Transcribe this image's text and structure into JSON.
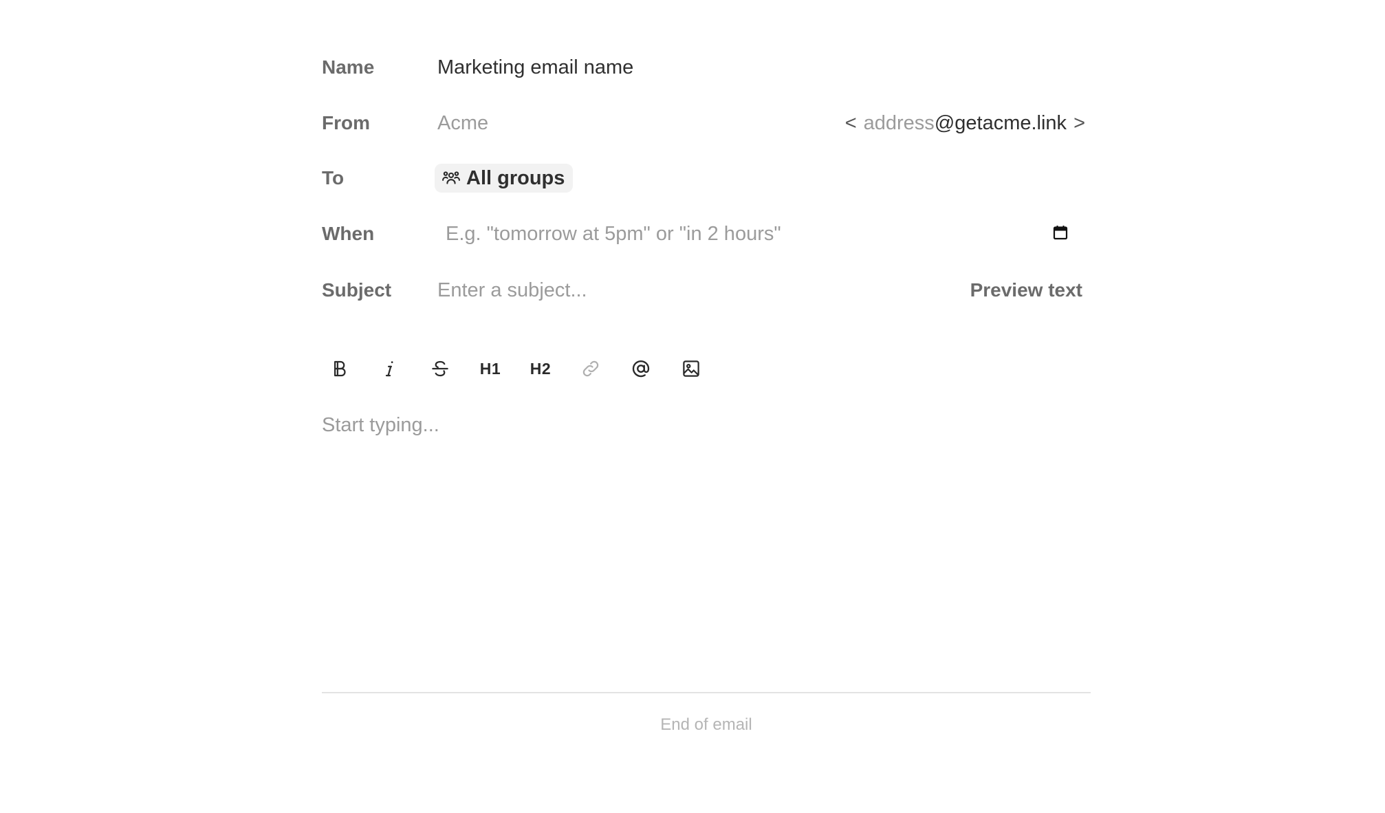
{
  "form": {
    "name": {
      "label": "Name",
      "value": "Marketing email name"
    },
    "from": {
      "label": "From",
      "placeholder": "Acme",
      "address_open": "<",
      "address_placeholder": "address",
      "address_domain": "@getacme.link",
      "address_close": ">"
    },
    "to": {
      "label": "To",
      "chip_label": "All groups",
      "chip_icon": "users-group-icon"
    },
    "when": {
      "label": "When",
      "placeholder": "E.g. \"tomorrow at 5pm\" or \"in 2 hours\"",
      "icon": "calendar-icon"
    },
    "subject": {
      "label": "Subject",
      "placeholder": "Enter a subject...",
      "preview_button": "Preview text"
    }
  },
  "toolbar": {
    "h1_label": "H1",
    "h2_label": "H2",
    "tools": [
      "bold-icon",
      "italic-icon",
      "strikethrough-icon",
      "heading-1",
      "heading-2",
      "link-icon",
      "mention-icon",
      "image-icon"
    ]
  },
  "editor": {
    "placeholder": "Start typing..."
  },
  "footer": {
    "end_label": "End of email"
  },
  "colors": {
    "label": "#6b6b6b",
    "text": "#2f2f2f",
    "placeholder": "#9b9b9b",
    "chip_bg": "#f2f2f2",
    "divider": "#e3e3e3",
    "end_label": "#b5b5b5"
  }
}
